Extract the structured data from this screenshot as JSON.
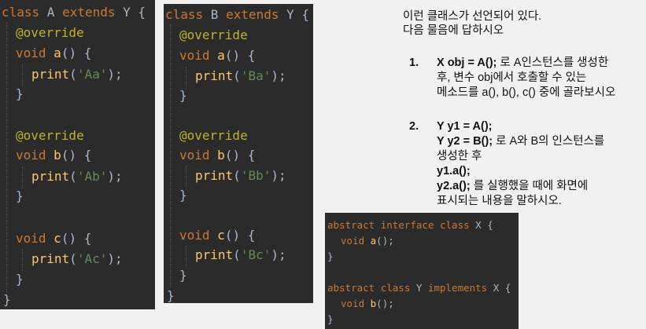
{
  "panel_a": {
    "lines": [
      {
        "parts": [
          [
            "kw",
            "class "
          ],
          [
            "cls",
            "A "
          ],
          [
            "kw",
            "extends "
          ],
          [
            "cls",
            "Y {"
          ]
        ]
      },
      {
        "parts": [
          [
            "ann",
            "@override"
          ]
        ]
      },
      {
        "parts": [
          [
            "kw",
            "void "
          ],
          [
            "fn",
            "a"
          ],
          [
            "cls",
            "() {"
          ]
        ]
      },
      {
        "parts": [
          [
            "fn",
            "print"
          ],
          [
            "cls",
            "("
          ],
          [
            "str",
            "'Aa'"
          ],
          [
            "cls",
            ");"
          ]
        ]
      },
      {
        "parts": [
          [
            "cls",
            "}"
          ]
        ]
      },
      {
        "parts": [
          [
            "ann",
            "@override"
          ]
        ]
      },
      {
        "parts": [
          [
            "kw",
            "void "
          ],
          [
            "fn",
            "b"
          ],
          [
            "cls",
            "() {"
          ]
        ]
      },
      {
        "parts": [
          [
            "fn",
            "print"
          ],
          [
            "cls",
            "("
          ],
          [
            "str",
            "'Ab'"
          ],
          [
            "cls",
            ");"
          ]
        ]
      },
      {
        "parts": [
          [
            "cls",
            "}"
          ]
        ]
      },
      {
        "parts": [
          [
            "kw",
            "void "
          ],
          [
            "fn",
            "c"
          ],
          [
            "cls",
            "() {"
          ]
        ]
      },
      {
        "parts": [
          [
            "fn",
            "print"
          ],
          [
            "cls",
            "("
          ],
          [
            "str",
            "'Ac'"
          ],
          [
            "cls",
            ");"
          ]
        ]
      },
      {
        "parts": [
          [
            "cls",
            "}"
          ]
        ]
      },
      {
        "parts": [
          [
            "cls",
            "}"
          ]
        ]
      }
    ]
  },
  "panel_b": {
    "lines": [
      {
        "parts": [
          [
            "kw",
            "class "
          ],
          [
            "cls",
            "B "
          ],
          [
            "kw",
            "extends "
          ],
          [
            "cls",
            "Y {"
          ]
        ]
      },
      {
        "parts": [
          [
            "ann",
            "@override"
          ]
        ]
      },
      {
        "parts": [
          [
            "kw",
            "void "
          ],
          [
            "fn",
            "a"
          ],
          [
            "cls",
            "() {"
          ]
        ]
      },
      {
        "parts": [
          [
            "fn",
            "print"
          ],
          [
            "cls",
            "("
          ],
          [
            "str",
            "'Ba'"
          ],
          [
            "cls",
            ");"
          ]
        ]
      },
      {
        "parts": [
          [
            "cls",
            "}"
          ]
        ]
      },
      {
        "parts": [
          [
            "ann",
            "@override"
          ]
        ]
      },
      {
        "parts": [
          [
            "kw",
            "void "
          ],
          [
            "fn",
            "b"
          ],
          [
            "cls",
            "() {"
          ]
        ]
      },
      {
        "parts": [
          [
            "fn",
            "print"
          ],
          [
            "cls",
            "("
          ],
          [
            "str",
            "'Bb'"
          ],
          [
            "cls",
            ");"
          ]
        ]
      },
      {
        "parts": [
          [
            "cls",
            "}"
          ]
        ]
      },
      {
        "parts": [
          [
            "kw",
            "void "
          ],
          [
            "fn",
            "c"
          ],
          [
            "cls",
            "() {"
          ]
        ]
      },
      {
        "parts": [
          [
            "fn",
            "print"
          ],
          [
            "cls",
            "("
          ],
          [
            "str",
            "'Bc'"
          ],
          [
            "cls",
            ");"
          ]
        ]
      },
      {
        "parts": [
          [
            "cls",
            "}"
          ]
        ]
      },
      {
        "parts": [
          [
            "cls",
            "}"
          ]
        ]
      }
    ]
  },
  "panel_xy": {
    "lines": [
      {
        "parts": [
          [
            "kw",
            "abstract "
          ],
          [
            "kw",
            "interface "
          ],
          [
            "kw",
            "class "
          ],
          [
            "cls",
            "X {"
          ]
        ]
      },
      {
        "parts": [
          [
            "kw",
            "void "
          ],
          [
            "fn",
            "a"
          ],
          [
            "cls",
            "();"
          ]
        ]
      },
      {
        "parts": [
          [
            "cls",
            "}"
          ]
        ]
      },
      {
        "parts": [
          [
            "kw",
            "abstract "
          ],
          [
            "kw",
            "class "
          ],
          [
            "cls",
            "Y "
          ],
          [
            "kw",
            "implements "
          ],
          [
            "cls",
            "X {"
          ]
        ]
      },
      {
        "parts": [
          [
            "kw",
            "void "
          ],
          [
            "fn",
            "b"
          ],
          [
            "cls",
            "();"
          ]
        ]
      },
      {
        "parts": [
          [
            "cls",
            "}"
          ]
        ]
      }
    ]
  },
  "intro": {
    "line1": "이런 클래스가 선언되어 있다.",
    "line2": "다음 물음에 답하시오"
  },
  "q1": {
    "number": "1.",
    "code": "X obj = A();",
    "text1": " 로 A인스턴스를 생성한",
    "text2": "후, 변수 obj에서 호출할 수 있는",
    "text3": "메소드를 a(), b(), c() 중에 골라보시오"
  },
  "q2": {
    "number": "2.",
    "code1": "Y y1 = A();",
    "code2": "Y y2 = B();",
    "text1": " 로 A와 B의 인스턴스를",
    "text2": "생성한 후",
    "code3": "y1.a();",
    "code4": "y2.a();",
    "text3": " 를 실행했을 때에 화면에",
    "text4": "표시되는 내용을 말하시오."
  },
  "colors": {
    "editor_bg": "#2b2b2b",
    "keyword": "#cc7832",
    "annotation": "#bbb529",
    "function": "#ffc66d",
    "string": "#6a8759",
    "plain": "#a9b7c6"
  }
}
